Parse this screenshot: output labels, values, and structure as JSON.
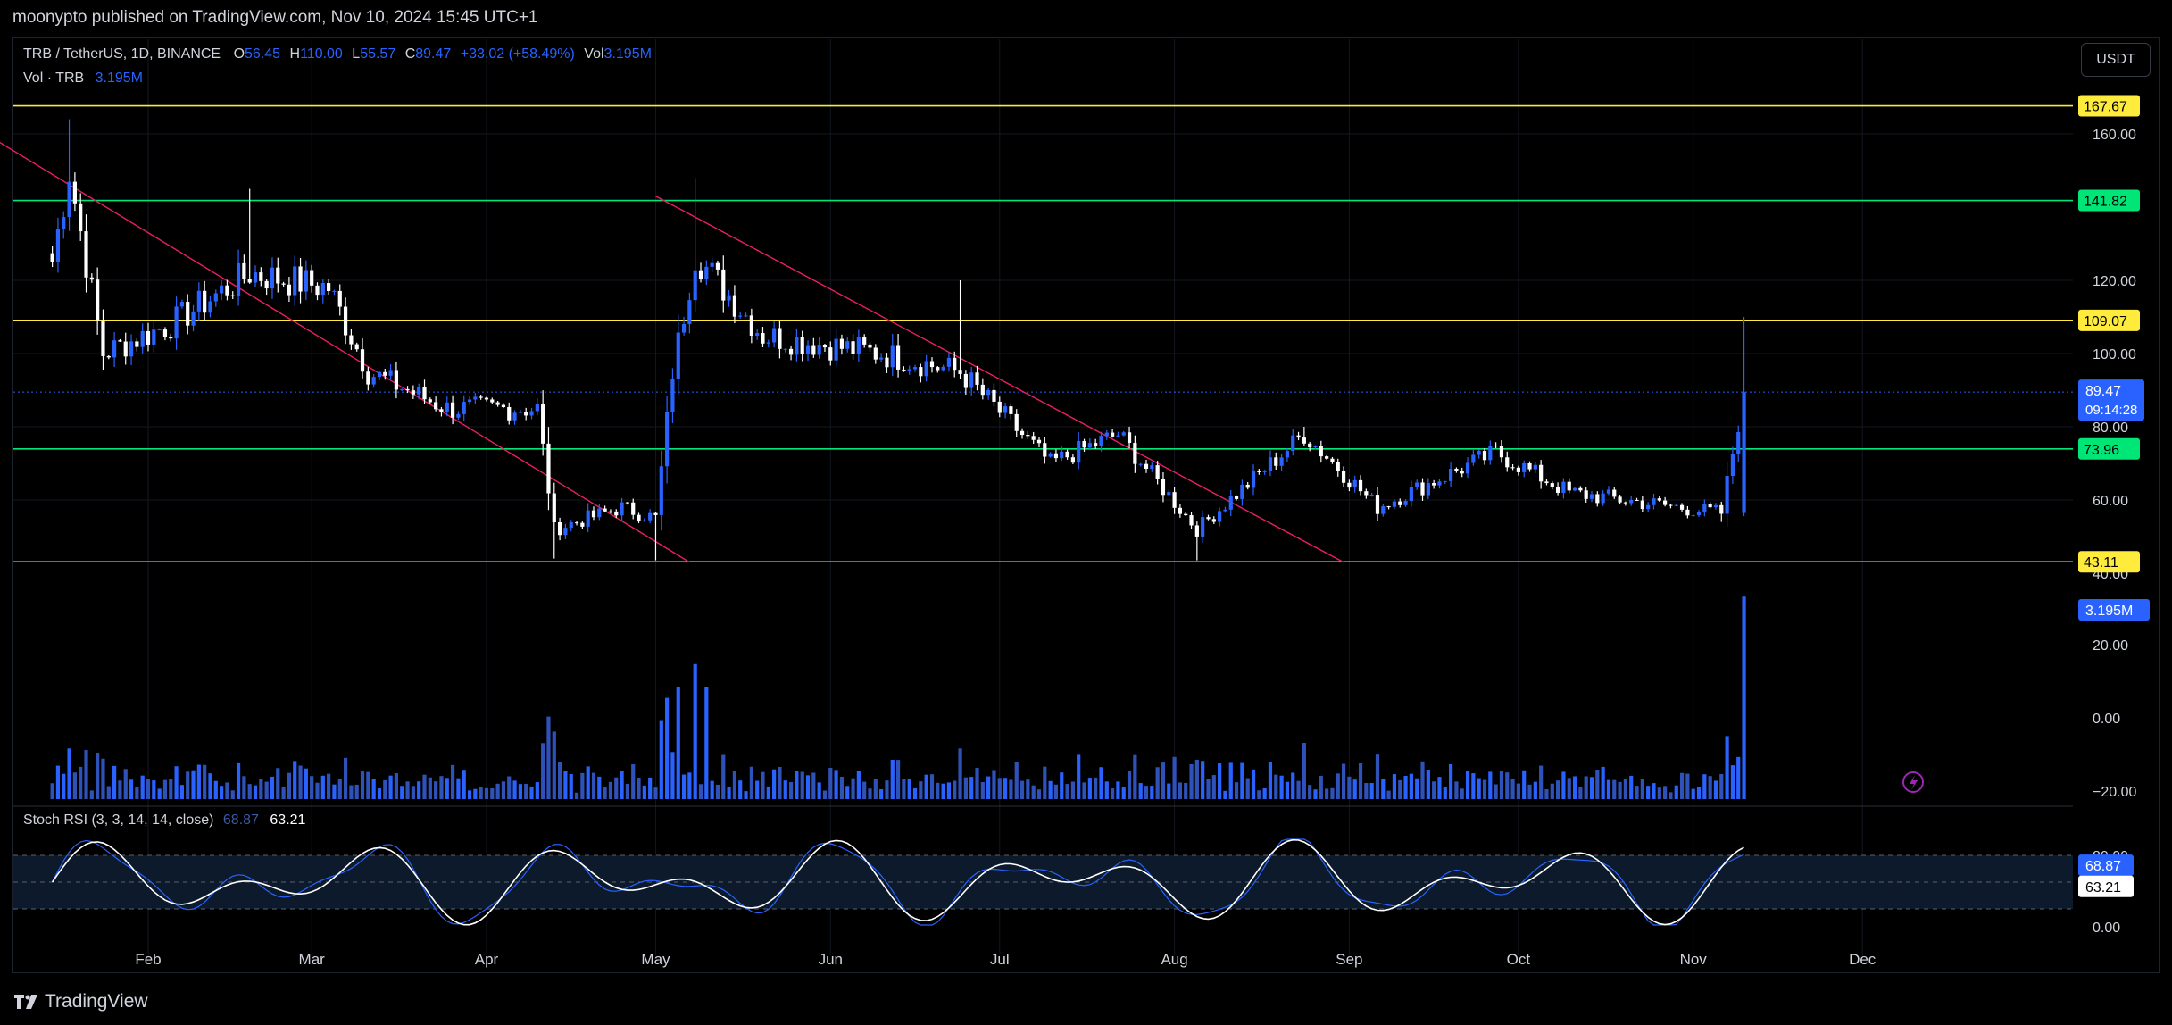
{
  "header": {
    "published": "moonypto published on TradingView.com, Nov 10, 2024 15:45 UTC+1"
  },
  "footer": {
    "brand": "TradingView"
  },
  "currency_button": "USDT",
  "legend": {
    "symbol": "TRB / TetherUS, 1D, BINANCE",
    "o_label": "O",
    "o": "56.45",
    "h_label": "H",
    "h": "110.00",
    "l_label": "L",
    "l": "55.57",
    "c_label": "C",
    "c": "89.47",
    "change": "+33.02 (+58.49%)",
    "vol_label": "Vol",
    "vol": "3.195M",
    "vol_row_label": "Vol · TRB",
    "vol_row_value": "3.195M",
    "stoch_label": "Stoch RSI (3, 3, 14, 14, close)",
    "stoch_k": "68.87",
    "stoch_d": "63.21"
  },
  "colors": {
    "up": "#2962ff",
    "down": "#ffffff",
    "yellow": "#ffeb3b",
    "green": "#00e676",
    "trend": "#e91e63",
    "stoch_k": "#2962ff",
    "stoch_d": "#ffffff"
  },
  "chart_data": [
    {
      "type": "candlestick",
      "title": "TRB / TetherUS, 1D, BINANCE",
      "price_ticks": [
        "160.00",
        "120.00",
        "100.00",
        "80.00",
        "60.00",
        "40.00"
      ],
      "x_ticks": [
        "Feb",
        "Mar",
        "Apr",
        "May",
        "Jun",
        "Jul",
        "Aug",
        "Sep",
        "Oct",
        "Nov",
        "Dec"
      ],
      "horizontal_levels": [
        {
          "value": 167.67,
          "label": "167.67",
          "color": "yellow"
        },
        {
          "value": 141.82,
          "label": "141.82",
          "color": "green"
        },
        {
          "value": 109.07,
          "label": "109.07",
          "color": "yellow"
        },
        {
          "value": 73.96,
          "label": "73.96",
          "color": "green"
        },
        {
          "value": 43.11,
          "label": "43.11",
          "color": "yellow"
        }
      ],
      "last_price": {
        "value": 89.47,
        "label": "89.47",
        "countdown": "09:14:28"
      },
      "volume_axis_ticks": [
        "20.00",
        "0.00",
        "−20.00"
      ],
      "volume_last_label": "3.195M",
      "key_points": [
        {
          "date": "2024-01-15",
          "close": 125
        },
        {
          "date": "2024-01-18",
          "high": 164,
          "close": 150
        },
        {
          "date": "2024-01-24",
          "close": 100
        },
        {
          "date": "2024-02-05",
          "close": 108
        },
        {
          "date": "2024-02-19",
          "high": 145,
          "close": 122
        },
        {
          "date": "2024-03-04",
          "close": 118
        },
        {
          "date": "2024-03-11",
          "close": 95
        },
        {
          "date": "2024-03-25",
          "close": 85
        },
        {
          "date": "2024-04-10",
          "close": 85
        },
        {
          "date": "2024-04-13",
          "low": 44,
          "close": 52
        },
        {
          "date": "2024-04-25",
          "close": 58
        },
        {
          "date": "2024-05-01",
          "low": 43.5,
          "close": 55
        },
        {
          "date": "2024-05-04",
          "close": 95
        },
        {
          "date": "2024-05-08",
          "high": 148,
          "close": 127
        },
        {
          "date": "2024-05-20",
          "close": 105
        },
        {
          "date": "2024-06-10",
          "close": 100
        },
        {
          "date": "2024-06-24",
          "high": 120,
          "close": 95
        },
        {
          "date": "2024-07-10",
          "close": 70
        },
        {
          "date": "2024-07-22",
          "close": 78
        },
        {
          "date": "2024-08-05",
          "low": 43.5,
          "close": 52
        },
        {
          "date": "2024-08-24",
          "high": 80,
          "close": 78
        },
        {
          "date": "2024-09-06",
          "close": 58
        },
        {
          "date": "2024-09-27",
          "close": 73
        },
        {
          "date": "2024-10-10",
          "close": 62
        },
        {
          "date": "2024-11-06",
          "low": 54,
          "close": 56.45
        },
        {
          "date": "2024-11-10",
          "open": 56.45,
          "high": 110,
          "low": 55.57,
          "close": 89.47
        }
      ]
    },
    {
      "type": "line",
      "title": "Stoch RSI (3, 3, 14, 14, close)",
      "y_ticks": [
        "80.00",
        "0.00"
      ],
      "band": [
        20,
        80
      ],
      "series": [
        {
          "name": "K",
          "last": 68.87
        },
        {
          "name": "D",
          "last": 63.21
        }
      ]
    }
  ]
}
